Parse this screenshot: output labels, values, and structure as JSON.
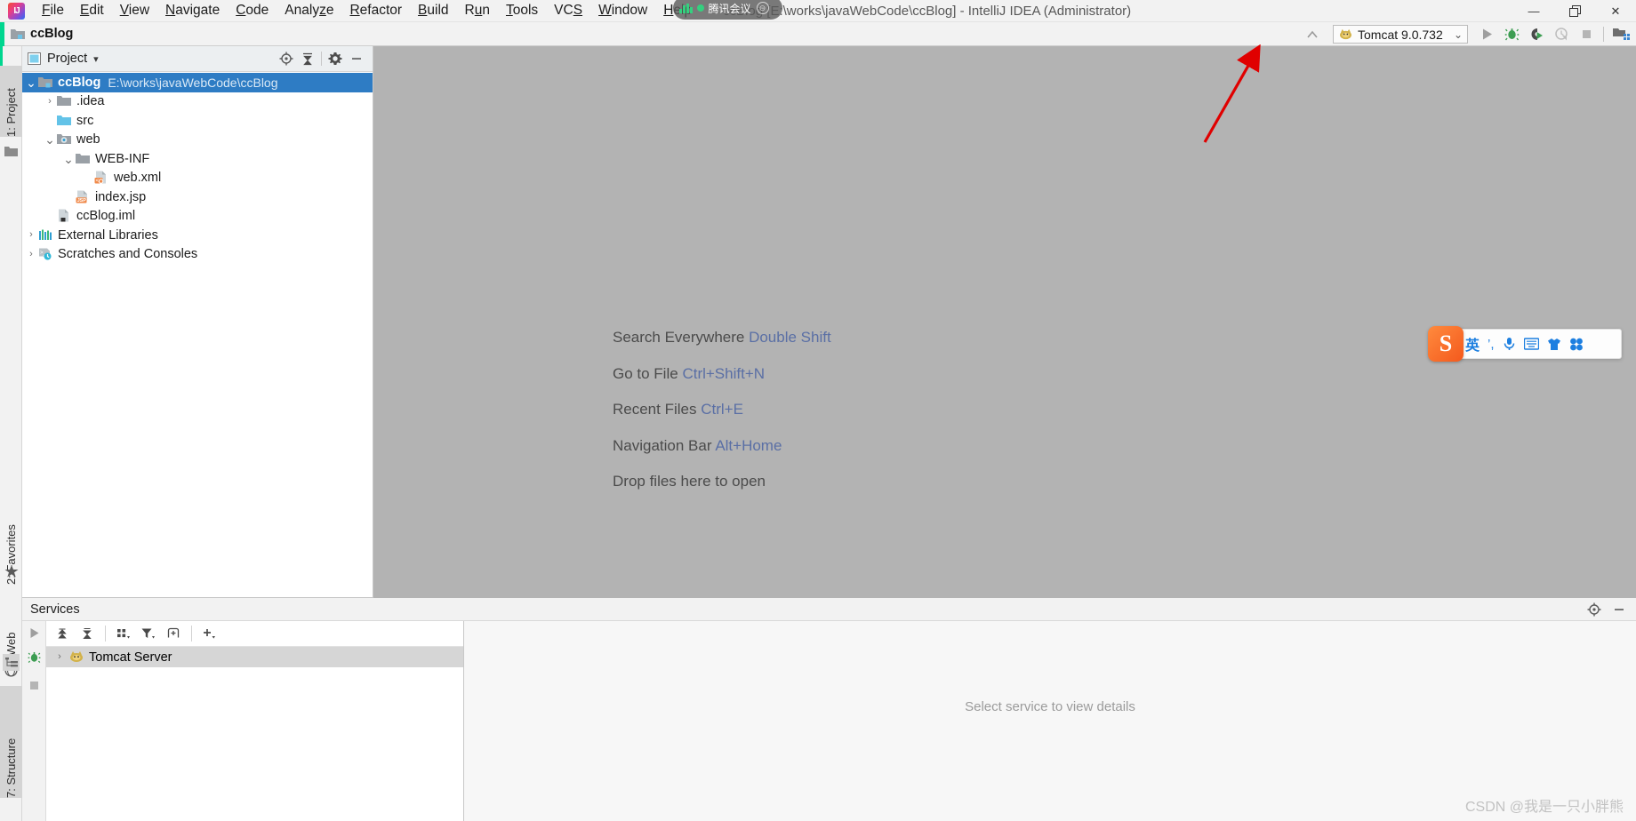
{
  "window": {
    "title": "ccBlog [E:\\works\\javaWebCode\\ccBlog] - IntelliJ IDEA (Administrator)",
    "minimize": "—",
    "restore": "❐",
    "close": "✕"
  },
  "menubar": {
    "items": [
      {
        "label": "File",
        "mnemonic": "F"
      },
      {
        "label": "Edit",
        "mnemonic": "E"
      },
      {
        "label": "View",
        "mnemonic": "V"
      },
      {
        "label": "Navigate",
        "mnemonic": "N"
      },
      {
        "label": "Code",
        "mnemonic": "C"
      },
      {
        "label": "Analyze",
        "mnemonic": "z"
      },
      {
        "label": "Refactor",
        "mnemonic": "R"
      },
      {
        "label": "Build",
        "mnemonic": "B"
      },
      {
        "label": "Run",
        "mnemonic": "u"
      },
      {
        "label": "Tools",
        "mnemonic": "T"
      },
      {
        "label": "VCS",
        "mnemonic": "S"
      },
      {
        "label": "Window",
        "mnemonic": "W"
      },
      {
        "label": "Help",
        "mnemonic": "H"
      }
    ]
  },
  "overlay_meeting": {
    "app_name": "腾讯会议",
    "minimize_glyph": "⊖"
  },
  "navbar": {
    "breadcrumb": "ccBlog",
    "run_config": {
      "name": "Tomcat 9.0.732",
      "chevron": "⌄"
    },
    "buttons": [
      {
        "name": "run",
        "tooltip": "Run"
      },
      {
        "name": "debug",
        "tooltip": "Debug"
      },
      {
        "name": "run-with-coverage",
        "tooltip": "Run with Coverage"
      },
      {
        "name": "profiler",
        "tooltip": "Profiler"
      },
      {
        "name": "stop",
        "tooltip": "Stop"
      },
      {
        "name": "project-structure",
        "tooltip": "Project Structure"
      }
    ]
  },
  "left_rail": {
    "tabs": [
      {
        "label": "1: Project",
        "number": "1"
      },
      {
        "label": "2: Favorites",
        "number": "2"
      },
      {
        "label": "Web",
        "number": ""
      },
      {
        "label": "7: Structure",
        "number": "7"
      }
    ]
  },
  "project_panel": {
    "title": "Project",
    "dropdown_glyph": "▾",
    "toolbar": [
      {
        "name": "scroll-from-source-icon",
        "glyph": "⊕"
      },
      {
        "name": "collapse-all-icon",
        "glyph": "⤓"
      },
      {
        "name": "settings-gear-icon",
        "glyph": "⚙"
      },
      {
        "name": "hide-icon",
        "glyph": "—"
      }
    ],
    "tree": [
      {
        "label": "ccBlog",
        "path": "E:\\works\\javaWebCode\\ccBlog",
        "depth": 0,
        "arrow": "expanded",
        "icon": "module-folder",
        "selected": true,
        "bold": true
      },
      {
        "label": ".idea",
        "path": "",
        "depth": 1,
        "arrow": "collapsed",
        "icon": "folder-grey",
        "selected": false,
        "bold": false
      },
      {
        "label": "src",
        "path": "",
        "depth": 1,
        "arrow": "none",
        "icon": "folder-source",
        "selected": false,
        "bold": false
      },
      {
        "label": "web",
        "path": "",
        "depth": 1,
        "arrow": "expanded",
        "icon": "folder-web",
        "selected": false,
        "bold": false
      },
      {
        "label": "WEB-INF",
        "path": "",
        "depth": 2,
        "arrow": "expanded",
        "icon": "folder-grey",
        "selected": false,
        "bold": false
      },
      {
        "label": "web.xml",
        "path": "",
        "depth": 3,
        "arrow": "none",
        "icon": "file-xml",
        "selected": false,
        "bold": false
      },
      {
        "label": "index.jsp",
        "path": "",
        "depth": 2,
        "arrow": "none",
        "icon": "file-jsp",
        "selected": false,
        "bold": false
      },
      {
        "label": "ccBlog.iml",
        "path": "",
        "depth": 1,
        "arrow": "none",
        "icon": "file-iml",
        "selected": false,
        "bold": false
      },
      {
        "label": "External Libraries",
        "path": "",
        "depth": 0,
        "arrow": "collapsed",
        "icon": "libraries",
        "selected": false,
        "bold": false
      },
      {
        "label": "Scratches and Consoles",
        "path": "",
        "depth": 0,
        "arrow": "collapsed",
        "icon": "scratches",
        "selected": false,
        "bold": false
      }
    ]
  },
  "editor_hints": [
    {
      "text": "Search Everywhere",
      "key": "Double Shift"
    },
    {
      "text": "Go to File",
      "key": "Ctrl+Shift+N"
    },
    {
      "text": "Recent Files",
      "key": "Ctrl+E"
    },
    {
      "text": "Navigation Bar",
      "key": "Alt+Home"
    },
    {
      "text": "Drop files here to open",
      "key": ""
    }
  ],
  "ime_bar": {
    "logo": "S",
    "mode": "英",
    "items": [
      "’,",
      "mic-icon",
      "keyboard-icon",
      "skin-icon",
      "apps-icon"
    ]
  },
  "services_panel": {
    "title": "Services",
    "header_icons": [
      {
        "name": "services-settings-icon",
        "glyph": "⊕"
      },
      {
        "name": "services-hide-icon",
        "glyph": "—"
      }
    ],
    "toolbar": [
      {
        "name": "run-service-icon",
        "glyph": "▶"
      },
      {
        "name": "expand-all-icon",
        "glyph": "⤓"
      },
      {
        "name": "collapse-all-icon",
        "glyph": "⤒"
      },
      {
        "name": "group-by-icon",
        "glyph": "∷"
      },
      {
        "name": "filter-icon",
        "glyph": "▼"
      },
      {
        "name": "add-tab-icon",
        "glyph": "⊞"
      },
      {
        "name": "add-service-icon",
        "glyph": "＋"
      }
    ],
    "items": [
      {
        "label": "Tomcat Server",
        "arrow": "collapsed",
        "icon": "tomcat-icon"
      }
    ],
    "detail_placeholder": "Select service to view details"
  },
  "watermark": "CSDN @我是一只小胖熊",
  "colors": {
    "accent_green": "#00d68f",
    "selection_blue": "#2e7cc4",
    "hint_key_blue": "#5a6fa5",
    "editor_bg": "#b3b3b3",
    "annotation_red": "#e00000"
  }
}
